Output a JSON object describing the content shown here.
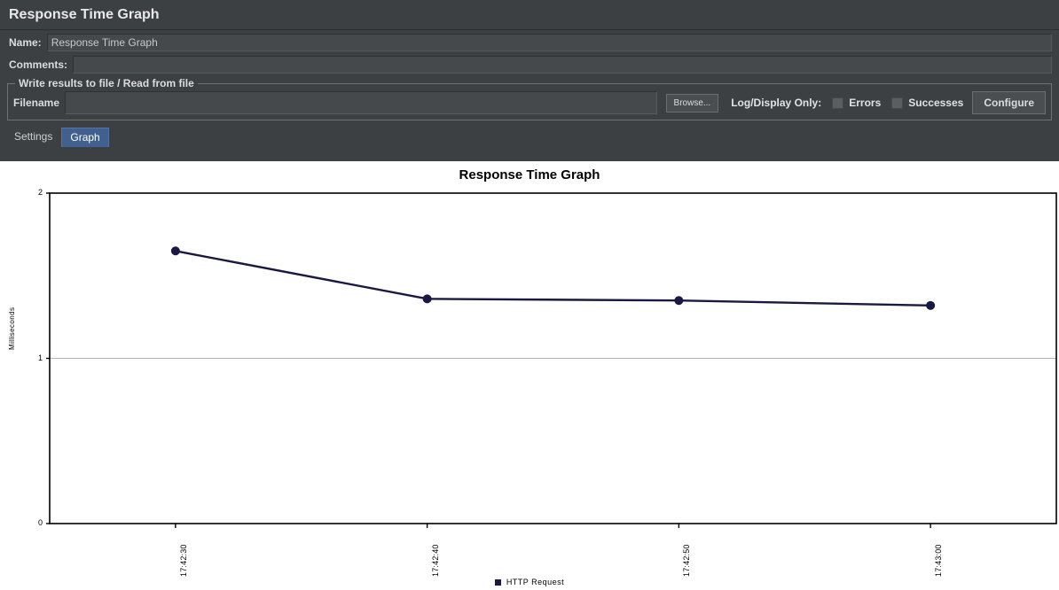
{
  "window": {
    "title": "Response Time Graph"
  },
  "form": {
    "name_label": "Name:",
    "name_value": "Response Time Graph",
    "comments_label": "Comments:",
    "comments_value": ""
  },
  "file_group": {
    "legend": "Write results to file / Read from file",
    "filename_label": "Filename",
    "filename_value": "",
    "browse_label": "Browse...",
    "log_display_label": "Log/Display Only:",
    "errors_label": "Errors",
    "errors_checked": false,
    "successes_label": "Successes",
    "successes_checked": false,
    "configure_label": "Configure"
  },
  "tabs": [
    {
      "label": "Settings",
      "active": false
    },
    {
      "label": "Graph",
      "active": true
    }
  ],
  "colors": {
    "panel_bg": "#3c4043",
    "tab_active": "#41608f",
    "series_line": "#191944",
    "gridline": "#b4b4b4",
    "axis": "#000000",
    "plot_bg": "#ffffff"
  },
  "chart_data": {
    "type": "line",
    "title": "Response Time Graph",
    "xlabel": "",
    "ylabel": "Milliseconds",
    "categories": [
      "17:42:30",
      "17:42:40",
      "17:42:50",
      "17:43:00"
    ],
    "x_tick_labels": [
      "17:42:30",
      "17:42:40",
      "17:42:50",
      "17:43:00"
    ],
    "y_tick_labels": [
      "0",
      "1",
      "2"
    ],
    "y_ticks": [
      0,
      1,
      2
    ],
    "ylim": [
      0,
      2
    ],
    "grid": true,
    "gridlines_y": [
      1
    ],
    "legend_position": "bottom",
    "series": [
      {
        "name": "HTTP Request",
        "color": "#191944",
        "values": [
          1.65,
          1.36,
          1.35,
          1.32
        ],
        "marker": "circle"
      }
    ]
  }
}
